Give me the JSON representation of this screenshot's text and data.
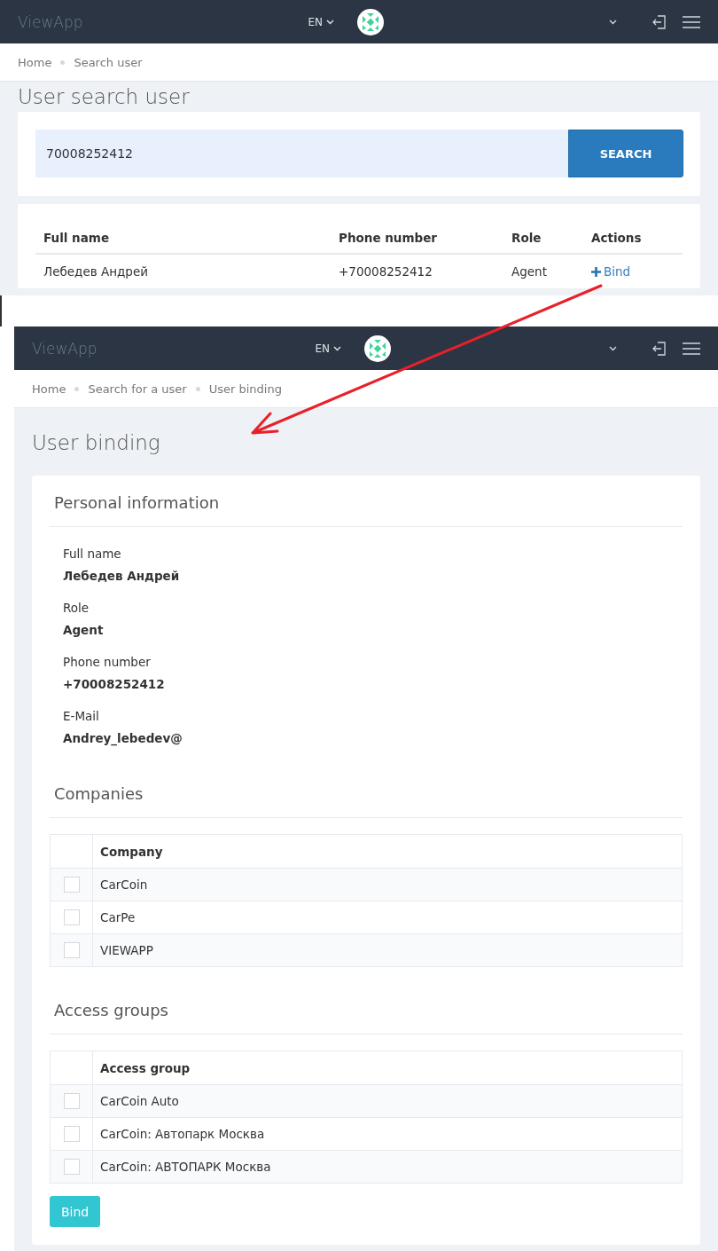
{
  "search_screen": {
    "header": {
      "brand": "ViewApp",
      "language": "EN"
    },
    "breadcrumbs": [
      "Home",
      "Search user"
    ],
    "title": "User search user",
    "search": {
      "value": "70008252412",
      "button": "SEARCH"
    },
    "results": {
      "columns": [
        "Full name",
        "Phone number",
        "Role",
        "Actions"
      ],
      "rows": [
        {
          "full_name": "Лебедев Андрей",
          "phone": "+70008252412",
          "role": "Agent",
          "action": "Bind"
        }
      ]
    }
  },
  "binding_screen": {
    "header": {
      "brand": "ViewApp",
      "language": "EN"
    },
    "breadcrumbs": [
      "Home",
      "Search for a user",
      "User binding"
    ],
    "title": "User binding",
    "personal": {
      "heading": "Personal information",
      "fields": [
        {
          "label": "Full name",
          "value": "Лебедев Андрей"
        },
        {
          "label": "Role",
          "value": "Agent"
        },
        {
          "label": "Phone number",
          "value": "+70008252412"
        },
        {
          "label": "E-Mail",
          "value": "Andrey_lebedev@"
        }
      ]
    },
    "companies": {
      "heading": "Companies",
      "column": "Company",
      "rows": [
        {
          "name": "CarCoin",
          "checked": false
        },
        {
          "name": "CarPe",
          "checked": false
        },
        {
          "name": "VIEWAPP",
          "checked": false
        }
      ]
    },
    "access_groups": {
      "heading": "Access groups",
      "column": "Access group",
      "rows": [
        {
          "name": "CarCoin Auto",
          "checked": false
        },
        {
          "name": "CarCoin: Автопарк Москва",
          "checked": false
        },
        {
          "name": "CarCoin: АВТОПАРК Москва",
          "checked": false
        }
      ]
    },
    "submit": "Bind"
  }
}
